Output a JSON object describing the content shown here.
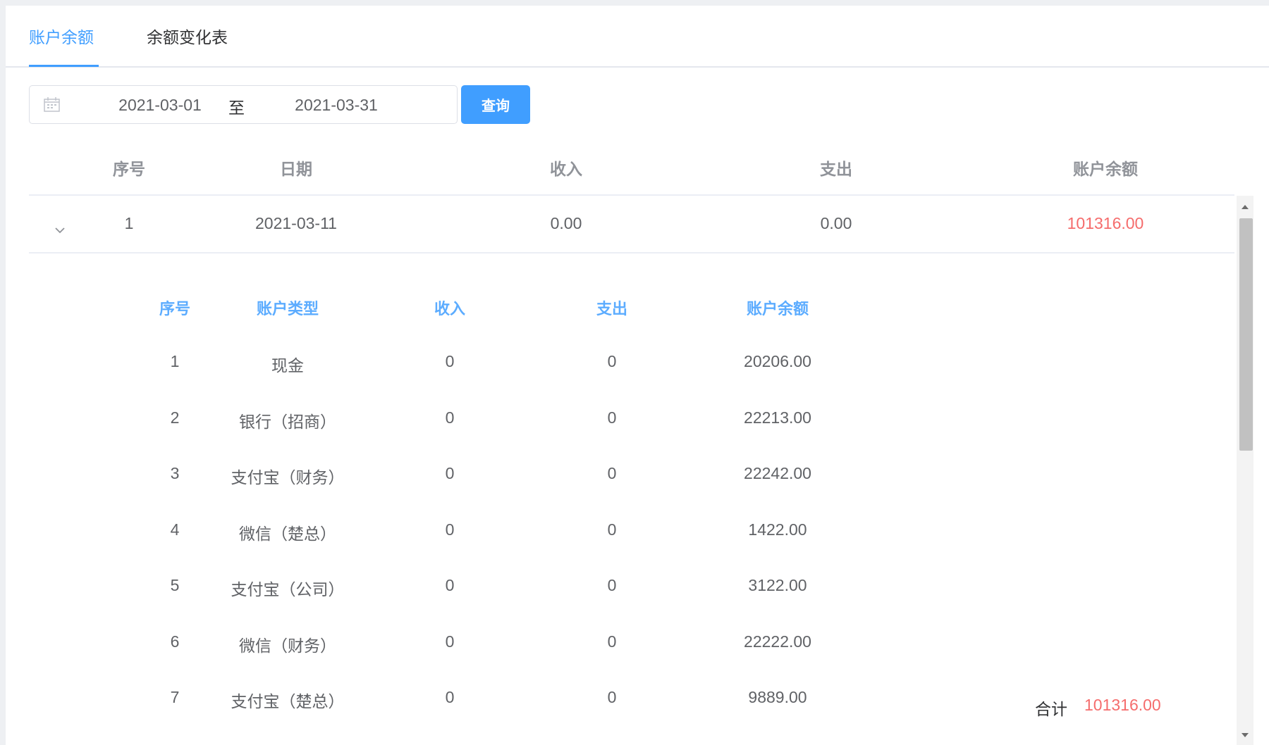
{
  "tabs": [
    {
      "label": "账户余额",
      "active": true
    },
    {
      "label": "余额变化表",
      "active": false
    }
  ],
  "date_range": {
    "start": "2021-03-01",
    "separator": "至",
    "end": "2021-03-31"
  },
  "query_button": "查询",
  "main_table": {
    "headers": [
      "序号",
      "日期",
      "收入",
      "支出",
      "账户余额"
    ],
    "rows": [
      {
        "index": "1",
        "date": "2021-03-11",
        "income": "0.00",
        "expense": "0.00",
        "balance": "101316.00"
      }
    ]
  },
  "detail_table": {
    "headers": [
      "序号",
      "账户类型",
      "收入",
      "支出",
      "账户余额"
    ],
    "rows": [
      [
        "1",
        "现金",
        "0",
        "0",
        "20206.00"
      ],
      [
        "2",
        "银行（招商）",
        "0",
        "0",
        "22213.00"
      ],
      [
        "3",
        "支付宝（财务）",
        "0",
        "0",
        "22242.00"
      ],
      [
        "4",
        "微信（楚总）",
        "0",
        "0",
        "1422.00"
      ],
      [
        "5",
        "支付宝（公司）",
        "0",
        "0",
        "3122.00"
      ],
      [
        "6",
        "微信（财务）",
        "0",
        "0",
        "22222.00"
      ],
      [
        "7",
        "支付宝（楚总）",
        "0",
        "0",
        "9889.00"
      ]
    ]
  },
  "total": {
    "label": "合计",
    "value": "101316.00"
  },
  "colors": {
    "primary": "#409eff",
    "danger": "#f56c6c"
  }
}
